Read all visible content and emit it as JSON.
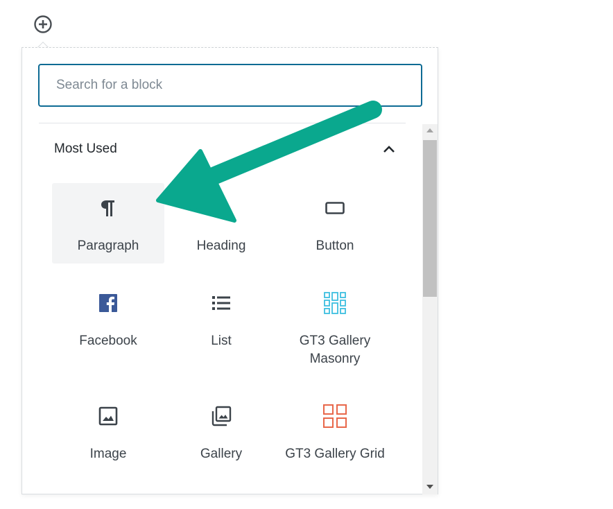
{
  "inserter": {
    "toggle_icon": "plus-circle-icon"
  },
  "search": {
    "placeholder": "Search for a block",
    "value": ""
  },
  "panel": {
    "title": "Most Used",
    "expanded": true,
    "chevron_icon": "chevron-up-icon"
  },
  "blocks": [
    {
      "label": "Paragraph",
      "icon": "paragraph-icon",
      "selected": true
    },
    {
      "label": "Heading",
      "icon": "heading-icon",
      "selected": false
    },
    {
      "label": "Button",
      "icon": "button-icon",
      "selected": false
    },
    {
      "label": "Facebook",
      "icon": "facebook-icon",
      "selected": false
    },
    {
      "label": "List",
      "icon": "list-icon",
      "selected": false
    },
    {
      "label": "GT3 Gallery Masonry",
      "icon": "masonry-gallery-icon",
      "selected": false
    },
    {
      "label": "Image",
      "icon": "image-icon",
      "selected": false
    },
    {
      "label": "Gallery",
      "icon": "gallery-icon",
      "selected": false
    },
    {
      "label": "GT3 Gallery Grid",
      "icon": "grid-gallery-icon",
      "selected": false
    }
  ],
  "colors": {
    "search_border": "#0e6b94",
    "annotation_arrow": "#0aa88e",
    "facebook_blue": "#3b5998",
    "masonry_cyan": "#3cbfe0",
    "grid_orange": "#e8674a",
    "selected_bg": "#f3f4f5"
  }
}
